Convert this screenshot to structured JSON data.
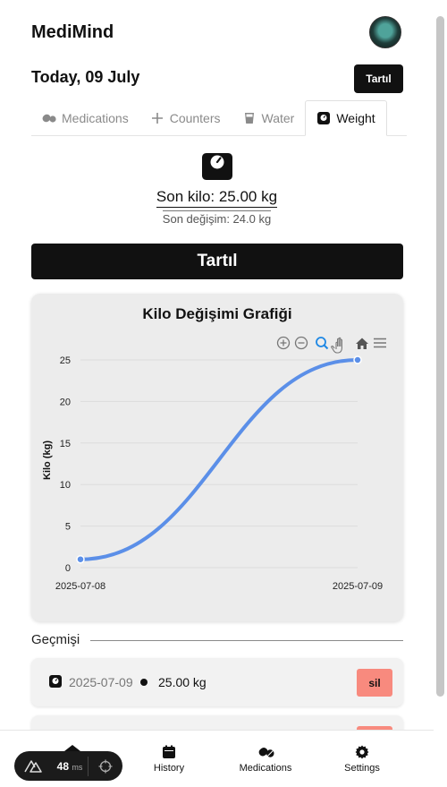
{
  "app": {
    "title": "MediMind"
  },
  "header": {
    "date": "Today, 09 July",
    "action_label": "Tartıl"
  },
  "tabs": [
    {
      "label": "Medications",
      "icon": "pills-icon",
      "active": false
    },
    {
      "label": "Counters",
      "icon": "plus-icon",
      "active": false
    },
    {
      "label": "Water",
      "icon": "glass-icon",
      "active": false
    },
    {
      "label": "Weight",
      "icon": "scale-icon",
      "active": true
    }
  ],
  "weight": {
    "last_weight": "Son kilo: 25.00 kg",
    "last_change": "Son değişim: 24.0 kg",
    "button_label": "Tartıl"
  },
  "chart": {
    "title": "Kilo Değişimi Grafiği",
    "toolbar_icons": [
      "zoom-in-icon",
      "zoom-out-icon",
      "zoom-select-icon",
      "pan-hand-icon",
      "home-icon",
      "menu-icon"
    ]
  },
  "chart_data": {
    "type": "line",
    "title": "Kilo Değişimi Grafiği",
    "ylabel": "Kilo (kg)",
    "xlabel": "",
    "x": [
      "2025-07-08",
      "2025-07-09"
    ],
    "series": [
      {
        "values": [
          1,
          25
        ]
      }
    ],
    "ylim": [
      0,
      25
    ],
    "yticks": [
      "0",
      "5",
      "10",
      "15",
      "20",
      "25"
    ],
    "grid": true,
    "color": "#5b8fe8"
  },
  "history": {
    "label": "Geçmişi",
    "rows": [
      {
        "date": "2025-07-09",
        "value": "25.00 kg",
        "delete_label": "sil"
      }
    ]
  },
  "nav": {
    "items": [
      {
        "label": "History",
        "icon": "calendar-icon"
      },
      {
        "label": "Medications",
        "icon": "pills-icon"
      },
      {
        "label": "Settings",
        "icon": "gear-icon"
      }
    ]
  },
  "devtools": {
    "ms_value": "48",
    "ms_unit": "ms"
  },
  "colors": {
    "accent": "#111111",
    "danger": "#f88a7e",
    "line": "#5b8fe8",
    "card": "#ececec"
  }
}
